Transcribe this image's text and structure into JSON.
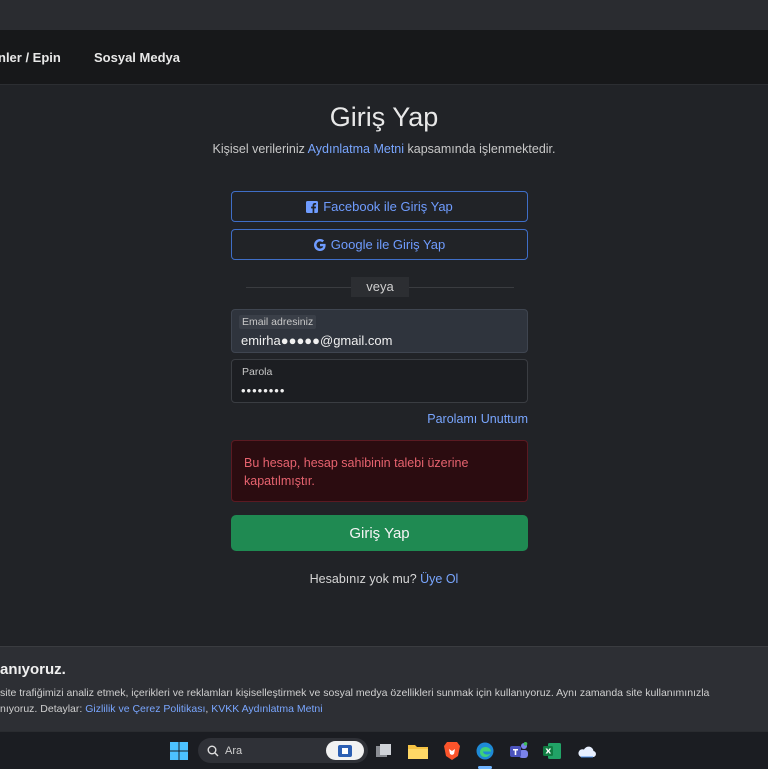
{
  "nav": {
    "items": [
      "nler / Epin",
      "Sosyal Medya"
    ]
  },
  "login": {
    "title": "Giriş Yap",
    "subtitle_pre": "Kişisel verileriniz ",
    "subtitle_link": "Aydınlatma Metni",
    "subtitle_post": " kapsamında işlenmektedir.",
    "facebook_label": "Facebook ile Giriş Yap",
    "google_label": "Google ile Giriş Yap",
    "divider": "veya",
    "email_label": "Email adresiniz",
    "email_value": "emirha●●●●●@gmail.com",
    "password_label": "Parola",
    "password_value": "••••••••",
    "forgot": "Parolamı Unuttum",
    "error": "Bu hesap, hesap sahibinin talebi üzerine kapatılmıştır.",
    "submit": "Giriş Yap",
    "signup_text": "Hesabınız yok mu? ",
    "signup_link": "Üye Ol"
  },
  "cookie": {
    "title": "anıyoruz.",
    "line1": "site trafiğimizi analiz etmek, içerikleri ve reklamları kişiselleştirmek ve sosyal medya özellikleri sunmak için kullanıyoruz. Aynı zamanda site kullanımınızla",
    "line2_pre": "nıyoruz. Detaylar: ",
    "link1": "Gizlilik ve Çerez Politikası",
    "sep": ", ",
    "link2": "KVKK Aydınlatma Metni"
  },
  "taskbar": {
    "search_placeholder": "Ara",
    "icons": [
      "windows-start-icon",
      "search-icon",
      "task-view-icon",
      "file-explorer-icon",
      "brave-browser-icon",
      "edge-browser-icon",
      "teams-icon",
      "excel-icon",
      "onedrive-icon"
    ]
  },
  "colors": {
    "accent": "#79a6ff",
    "success": "#1f8a52",
    "danger_text": "#e7636f",
    "danger_bg": "#2b0c10"
  }
}
